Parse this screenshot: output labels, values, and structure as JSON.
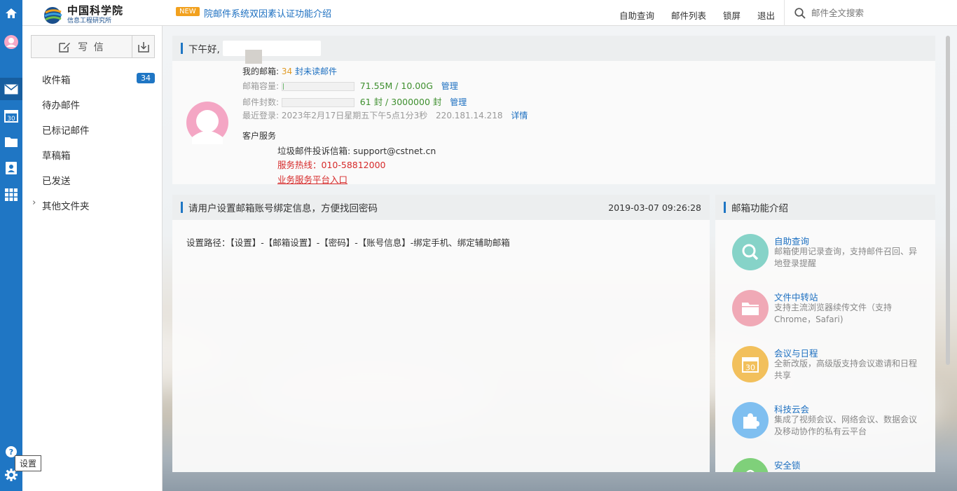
{
  "app": {
    "logo_title": "中国科学院",
    "logo_sub": "信息工程研究所"
  },
  "topbar": {
    "badge": "NEW",
    "notice": "院邮件系统双因素认证功能介绍",
    "nav": [
      "自助查询",
      "邮件列表",
      "锁屏",
      "退出"
    ],
    "search_placeholder": "邮件全文搜索"
  },
  "sidebar": {
    "compose_label": "写 信",
    "folders": [
      {
        "label": "收件箱",
        "count": "34"
      },
      {
        "label": "待办邮件"
      },
      {
        "label": "已标记邮件"
      },
      {
        "label": "草稿箱"
      },
      {
        "label": "已发送"
      },
      {
        "label": "其他文件夹",
        "expand": "›"
      }
    ]
  },
  "rail": {
    "icons": [
      "home-icon",
      "avatar-icon",
      "mail-icon",
      "calendar-icon",
      "folder-icon",
      "contacts-icon",
      "apps-icon",
      "help-icon",
      "settings-icon"
    ],
    "calendar_num": "30",
    "tooltip": "设置"
  },
  "welcome": {
    "greeting": "下午好,",
    "mailbox_label": "我的邮箱:",
    "unread_count": "34",
    "unread_text": "封未读邮件",
    "capacity_label": "邮箱容量:",
    "capacity_value": "71.55M / 10.00G",
    "capacity_ratio": 0.007,
    "capacity_manage": "管理",
    "count_label": "邮件封数:",
    "count_value": "61 封 / 3000000 封",
    "count_ratio": 0.0,
    "count_manage": "管理",
    "last_login": "最近登录: 2023年2月17日星期五下午5点1分3秒",
    "last_ip": "220.181.14.218",
    "detail_link": "详情",
    "service_title": "客户服务",
    "complaint": "垃圾邮件投诉信箱: support@cstnet.cn",
    "hotline": "服务热线：010-58812000",
    "portal_link": "业务服务平台入口"
  },
  "notice_panel": {
    "title": "请用户设置邮箱账号绑定信息，方便找回密码",
    "date": "2019-03-07 09:26:28",
    "body": "设置路径：【设置】-【邮箱设置】-【密码】-【账号信息】-绑定手机、绑定辅助邮箱"
  },
  "features": {
    "title": "邮箱功能介绍",
    "items": [
      {
        "title": "自助查询",
        "desc": "邮箱使用记录查询，支持邮件召回、异地登录提醒",
        "color": "#86d3c8",
        "icon": "search-icon"
      },
      {
        "title": "文件中转站",
        "desc": "支持主流浏览器续传文件（支持Chrome，Safari)",
        "color": "#f0a9b6",
        "icon": "folder-icon"
      },
      {
        "title": "会议与日程",
        "desc": "全新改版，高级版支持会议邀请和日程共享",
        "color": "#f2c05c",
        "icon": "calendar-icon",
        "num": "30"
      },
      {
        "title": "科技云会",
        "desc": "集成了视频会议、网络会议、数据会议及移动协作的私有云平台",
        "color": "#7fbff0",
        "icon": "puzzle-icon"
      },
      {
        "title": "安全锁",
        "desc": "",
        "color": "#7fd07a",
        "icon": "lock-icon"
      }
    ]
  },
  "colors": {
    "accent": "#1f76c4",
    "rail": "#1f76c4",
    "link": "#1c6fc0",
    "badge": "#f2a11e"
  }
}
